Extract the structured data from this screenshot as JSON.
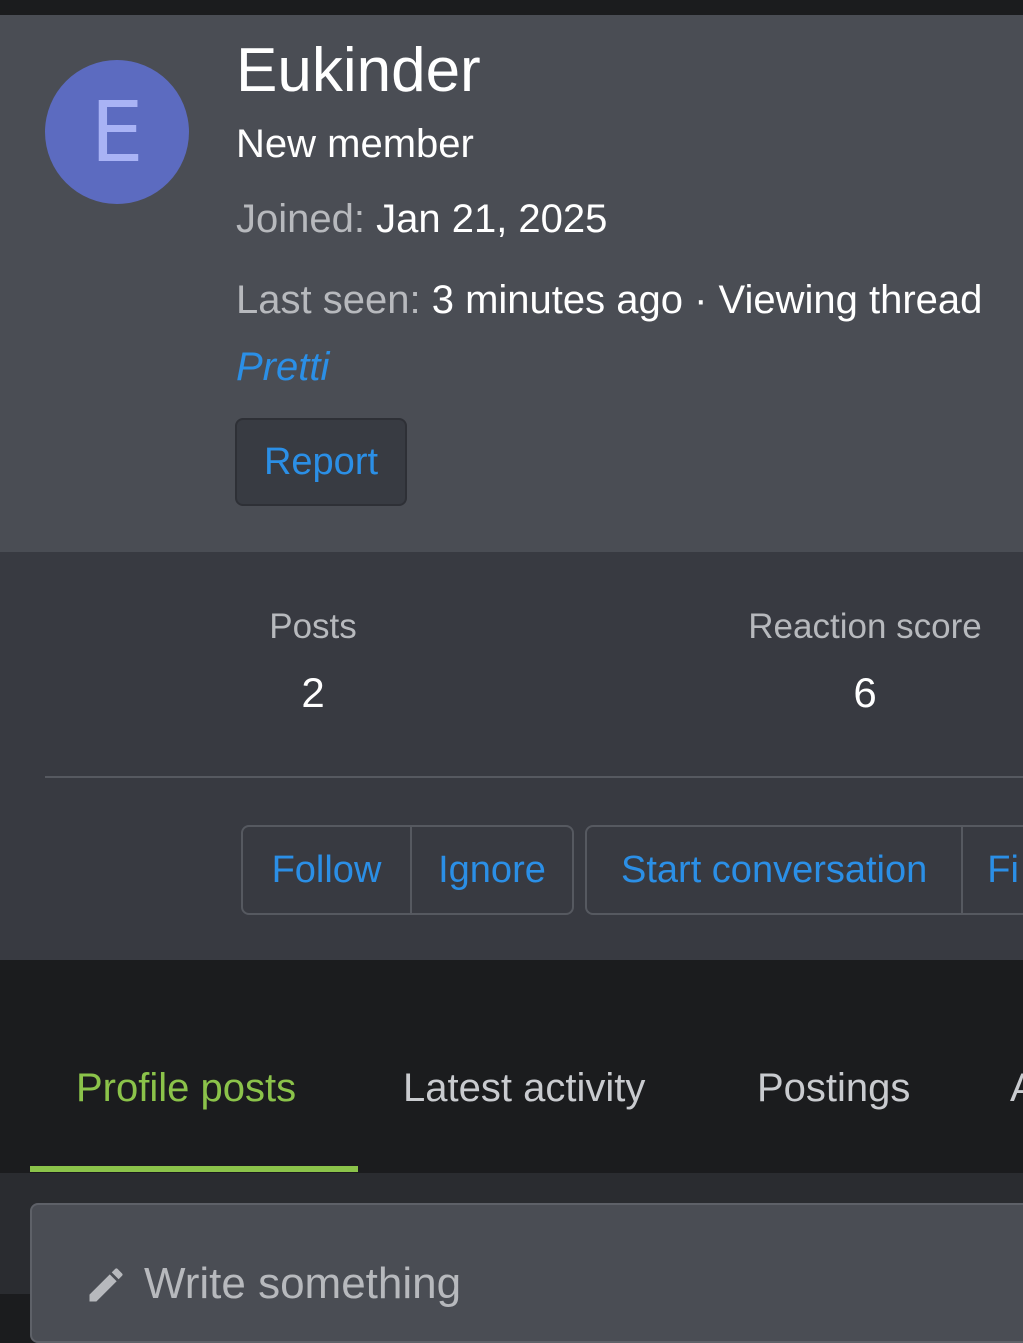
{
  "profile": {
    "avatar_letter": "E",
    "username": "Eukinder",
    "user_title": "New member",
    "joined_label": "Joined:",
    "joined_value": "Jan 21, 2025",
    "last_seen_label": "Last seen:",
    "last_seen_value": "3 minutes ago · Viewing thread",
    "thread_link": "Pretti",
    "report_button": "Report"
  },
  "stats": {
    "posts_label": "Posts",
    "posts_value": "2",
    "reaction_label": "Reaction score",
    "reaction_value": "6"
  },
  "actions": {
    "follow": "Follow",
    "ignore": "Ignore",
    "start_conversation": "Start conversation",
    "find_partial": "Fi"
  },
  "tabs": [
    {
      "label": "Profile posts",
      "active": true
    },
    {
      "label": "Latest activity",
      "active": false
    },
    {
      "label": "Postings",
      "active": false
    },
    {
      "label": "A",
      "active": false
    }
  ],
  "composer": {
    "placeholder": "Write something",
    "icon": "pencil-icon"
  },
  "colors": {
    "link": "#2b8fe6",
    "active_tab": "#8bc34a",
    "avatar_bg": "#5c6bc0",
    "header_bg": "#4a4d54",
    "stats_bg": "#383a41"
  }
}
